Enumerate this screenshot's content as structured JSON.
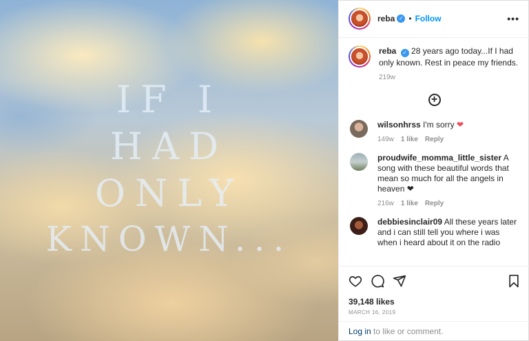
{
  "media": {
    "text_lines": [
      "IF I",
      "HAD",
      "ONLY",
      "KNOWN..."
    ]
  },
  "header": {
    "username": "reba",
    "separator": "•",
    "follow_label": "Follow",
    "more_icon": "more-horizontal-icon"
  },
  "caption": {
    "username": "reba",
    "text": "28 years ago today...If I had only known. Rest in peace my friends.",
    "time": "219w"
  },
  "load_more_icon": "plus-circle-icon",
  "comments": [
    {
      "username": "wilsonhrss",
      "text": "I'm sorry",
      "emoji": "❤",
      "time": "149w",
      "likes": "1 like",
      "reply": "Reply"
    },
    {
      "username": "proudwife_momma_little_sister",
      "text": "A song with these beautiful words that mean so much for all the angels in heaven",
      "emoji": "❤",
      "time": "216w",
      "likes": "1 like",
      "reply": "Reply"
    },
    {
      "username": "debbiesinclair09",
      "text": "All these years later and i can still tell you where i was when i heard about it on the radio",
      "emoji": "",
      "time": "",
      "likes": "",
      "reply": ""
    }
  ],
  "actions": {
    "like_icon": "heart-outline-icon",
    "comment_icon": "comment-icon",
    "share_icon": "paper-plane-icon",
    "save_icon": "bookmark-icon",
    "likes_count": "39,148 likes",
    "date": "MARCH 16, 2019"
  },
  "login": {
    "link": "Log in",
    "rest": " to like or comment."
  },
  "colors": {
    "accent": "#0095f6",
    "heart": "#ed4956",
    "verified": "#3897f0"
  }
}
